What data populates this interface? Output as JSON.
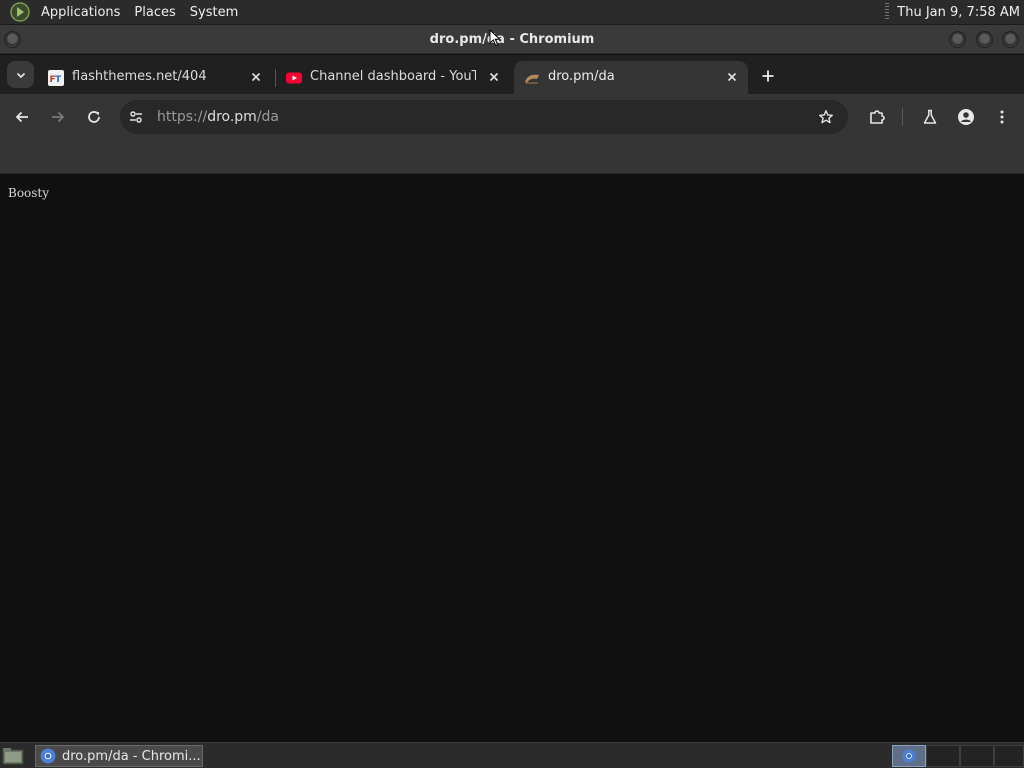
{
  "desktop_panel": {
    "menus": [
      "Applications",
      "Places",
      "System"
    ],
    "clock": "Thu Jan  9, 7:58 AM"
  },
  "window": {
    "title": "dro.pm/da - Chromium"
  },
  "tabs": [
    {
      "title": "flashthemes.net/404",
      "favicon": "ft-icon",
      "active": false
    },
    {
      "title": "Channel dashboard - YouTube",
      "favicon": "youtube-icon",
      "active": false
    },
    {
      "title": "dro.pm/da",
      "favicon": "dro-icon",
      "active": true
    }
  ],
  "omnibox": {
    "scheme": "https://",
    "host": "dro.pm",
    "path": "/da"
  },
  "page": {
    "text": "Boosty"
  },
  "taskbar": {
    "task_label": "dro.pm/da - Chromi..."
  },
  "colors": {
    "page_bg": "#101010",
    "toolbar_bg": "#353535",
    "tabstrip_bg": "#202020",
    "youtube_red": "#ff0033"
  }
}
